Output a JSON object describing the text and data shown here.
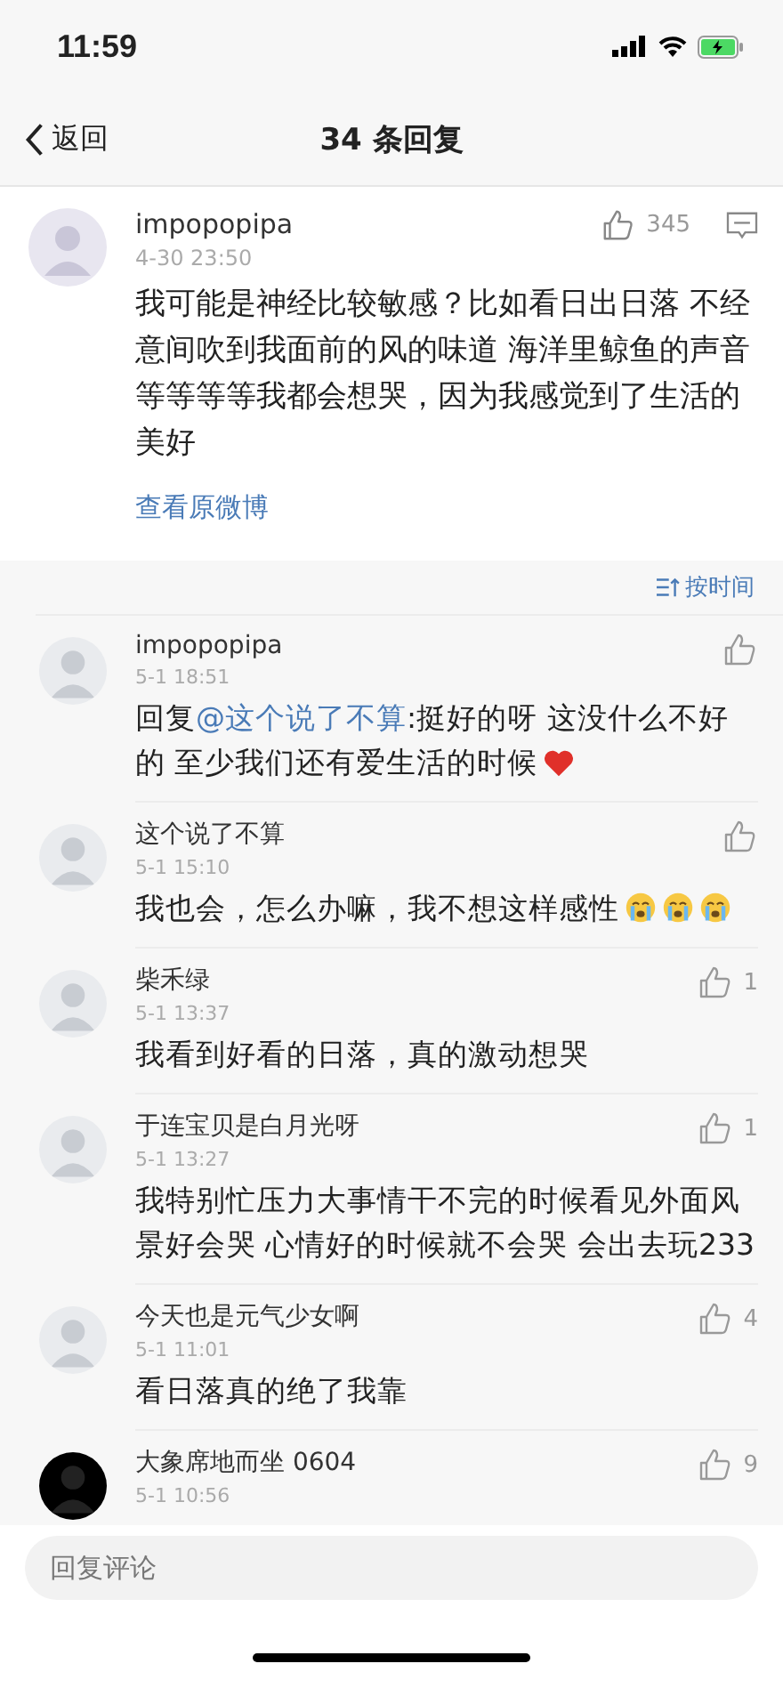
{
  "status_bar": {
    "time": "11:59"
  },
  "nav": {
    "back": "返回",
    "title": "34 条回复"
  },
  "post": {
    "user": "impopopipa",
    "time": "4-30 23:50",
    "likes": "345",
    "text": "我可能是神经比较敏感？比如看日出日落 不经意间吹到我面前的风的味道 海洋里鲸鱼的声音等等等等我都会想哭，因为我感觉到了生活的美好",
    "link": "查看原微博"
  },
  "sort": {
    "label": "按时间"
  },
  "comments": [
    {
      "user": "impopopipa",
      "time": "5-1 18:51",
      "prefix": "回复",
      "mention": "@这个说了不算",
      "text": ":挺好的呀 这没什么不好的 至少我们还有爱生活的时候",
      "emojis": [
        {
          "kind": "heart"
        }
      ]
    },
    {
      "user": "这个说了不算",
      "time": "5-1 15:10",
      "text": "我也会，怎么办嘛，我不想这样感性",
      "emojis": [
        {
          "kind": "crying"
        },
        {
          "kind": "crying"
        },
        {
          "kind": "crying"
        }
      ]
    },
    {
      "user": "柴禾绿",
      "time": "5-1 13:37",
      "likes": "1",
      "text": "我看到好看的日落，真的激动想哭"
    },
    {
      "user": "于连宝贝是白月光呀",
      "time": "5-1 13:27",
      "likes": "1",
      "text": "我特别忙压力大事情干不完的时候看见外面风景好会哭 心情好的时候就不会哭 会出去玩233"
    },
    {
      "user": "今天也是元气少女啊",
      "time": "5-1 11:01",
      "likes": "4",
      "text": "看日落真的绝了我靠"
    },
    {
      "user": "大象席地而坐 0604",
      "time": "5-1 10:56",
      "likes": "9"
    }
  ],
  "reply_field": {
    "placeholder": "回复评论"
  }
}
